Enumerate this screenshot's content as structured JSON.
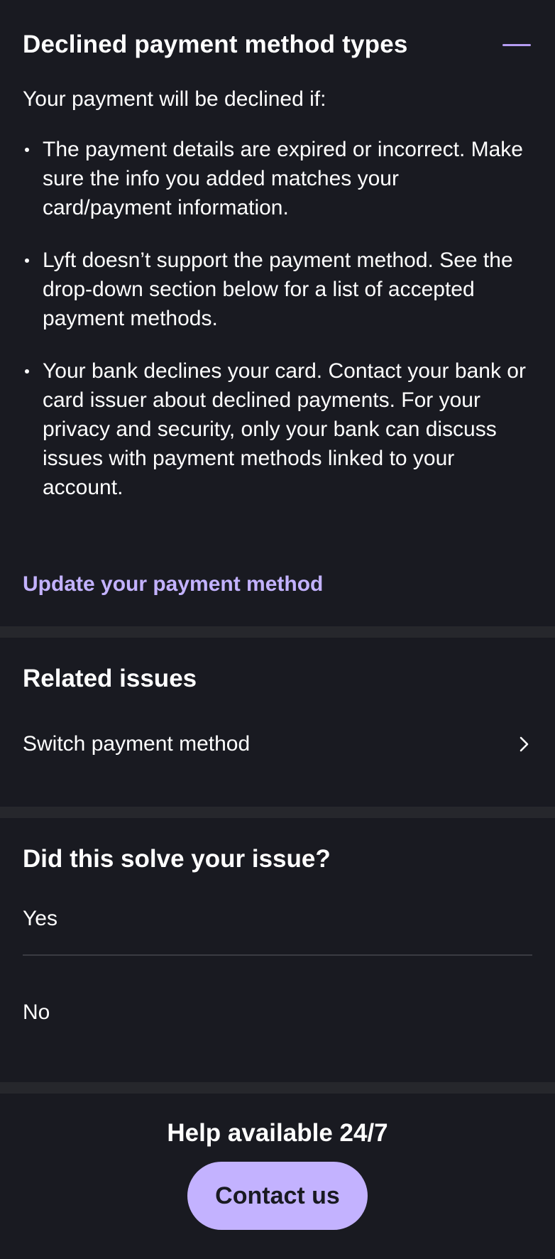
{
  "accordion": {
    "title": "Declined payment method types",
    "intro": "Your payment will be declined if:",
    "reasons": [
      "The payment details are expired or incorrect. Make sure the info you added matches your card/payment information.",
      "Lyft doesn’t support the payment method. See the drop-down section below for a list of accepted payment methods.",
      "Your bank declines your card. Contact your bank or card issuer about declined payments. For your privacy and security, only your bank can discuss issues with payment methods linked to your account."
    ],
    "link_label": "Update your payment method",
    "collapse_icon": "minus-icon"
  },
  "related": {
    "heading": "Related issues",
    "items": [
      {
        "label": "Switch payment method",
        "icon": "chevron-right-icon"
      }
    ]
  },
  "feedback": {
    "heading": "Did this solve your issue?",
    "yes_label": "Yes",
    "no_label": "No"
  },
  "help": {
    "title": "Help available 24/7",
    "button_label": "Contact us"
  },
  "colors": {
    "background": "#191a21",
    "divider": "#26272c",
    "accent": "#c3b2ff",
    "text": "#ffffff"
  }
}
